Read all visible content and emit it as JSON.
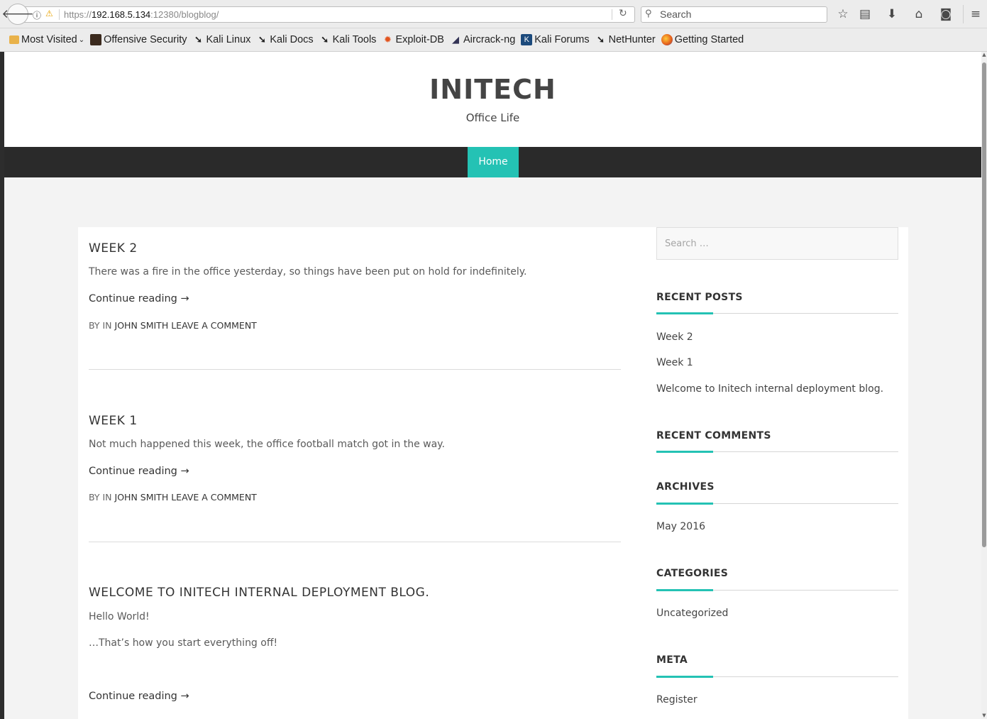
{
  "browser": {
    "url_scheme": "https://",
    "url_host": "192.168.5.134",
    "url_rest": ":12380/blogblog/",
    "search_placeholder": "Search",
    "bookmarks": [
      {
        "label": "Most Visited",
        "icon": "folder-icon"
      },
      {
        "label": "Offensive Security",
        "icon": "offsec-icon"
      },
      {
        "label": "Kali Linux",
        "icon": "kali-icon"
      },
      {
        "label": "Kali Docs",
        "icon": "kali-icon"
      },
      {
        "label": "Kali Tools",
        "icon": "kali-icon"
      },
      {
        "label": "Exploit-DB",
        "icon": "exploitdb-icon"
      },
      {
        "label": "Aircrack-ng",
        "icon": "aircrack-icon"
      },
      {
        "label": "Kali Forums",
        "icon": "forum-icon"
      },
      {
        "label": "NetHunter",
        "icon": "kali-icon"
      },
      {
        "label": "Getting Started",
        "icon": "firefox-icon"
      }
    ]
  },
  "site": {
    "title": "INITECH",
    "tagline": "Office Life",
    "nav": {
      "home": "Home"
    },
    "accent_color": "#24c2b4"
  },
  "posts": [
    {
      "title": "WEEK 2",
      "excerpt": [
        "There was a fire in the office yesterday, so things have been put on hold for indefinitely."
      ],
      "continue": "Continue reading →",
      "meta": {
        "by_in": "BY IN",
        "author": "JOHN SMITH",
        "comment": "LEAVE A COMMENT"
      }
    },
    {
      "title": "WEEK 1",
      "excerpt": [
        "Not much happened this week, the office football match got in the way."
      ],
      "continue": "Continue reading →",
      "meta": {
        "by_in": "BY IN",
        "author": "JOHN SMITH",
        "comment": "LEAVE A COMMENT"
      }
    },
    {
      "title": "WELCOME TO INITECH INTERNAL DEPLOYMENT BLOG.",
      "excerpt": [
        "Hello World!",
        "…That’s how you start everything off!"
      ],
      "continue": "Continue reading →"
    }
  ],
  "sidebar": {
    "search_placeholder": "Search …",
    "recent_posts": {
      "title": "RECENT POSTS",
      "items": [
        "Week 2",
        "Week 1",
        "Welcome to Initech internal deployment blog."
      ]
    },
    "recent_comments": {
      "title": "RECENT COMMENTS"
    },
    "archives": {
      "title": "ARCHIVES",
      "items": [
        "May 2016"
      ]
    },
    "categories": {
      "title": "CATEGORIES",
      "items": [
        "Uncategorized"
      ]
    },
    "meta": {
      "title": "META",
      "items": [
        "Register"
      ]
    }
  }
}
